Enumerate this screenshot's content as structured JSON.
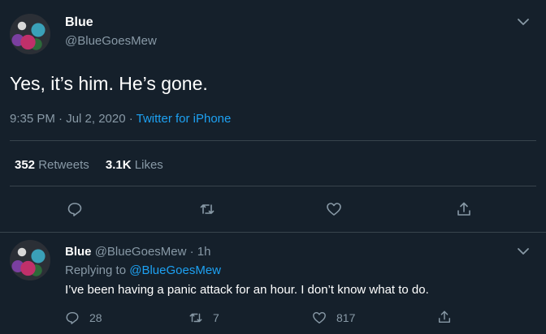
{
  "main_tweet": {
    "display_name": "Blue",
    "handle": "@BlueGoesMew",
    "text": "Yes, it’s him. He’s gone.",
    "time": "9:35 PM · Jul 2, 2020 · ",
    "source": "Twitter for iPhone",
    "retweets_count": "352",
    "retweets_label": "Retweets",
    "likes_count": "3.1K",
    "likes_label": "Likes"
  },
  "reply_tweet": {
    "display_name": "Blue",
    "handle_time": "@BlueGoesMew · 1h",
    "replying_prefix": "Replying to",
    "replying_handle": "@BlueGoesMew",
    "text": "I’ve been having a panic attack for an hour. I don’t know what to do.",
    "reply_count": "28",
    "retweet_count": "7",
    "like_count": "817"
  },
  "icons": {
    "chevron": "chevron-down-icon",
    "reply": "reply-icon",
    "retweet": "retweet-icon",
    "like": "heart-icon",
    "share": "share-icon"
  },
  "colors": {
    "background": "#15202b",
    "muted": "#8899a6",
    "link": "#1da1f2",
    "divider": "#38444d"
  }
}
